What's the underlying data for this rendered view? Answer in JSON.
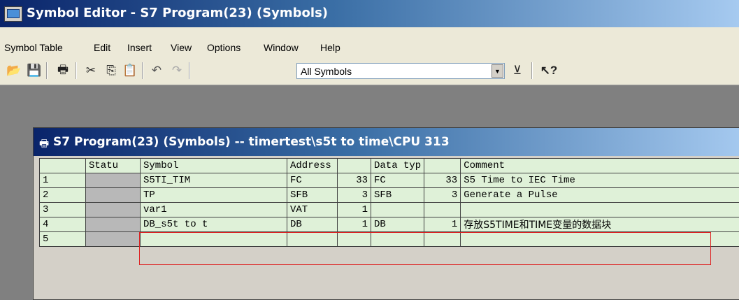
{
  "window": {
    "title": "Symbol Editor - S7 Program(23) (Symbols)"
  },
  "menu": [
    "Symbol Table",
    "Edit",
    "Insert",
    "View",
    "Options",
    "Window",
    "Help"
  ],
  "toolbar": {
    "icons": [
      "open-icon",
      "save-icon",
      "print-icon",
      "cut-icon",
      "copy-icon",
      "paste-icon",
      "undo-icon",
      "redo-icon",
      "filter-icon",
      "help-icon"
    ],
    "filter_value": "All Symbols"
  },
  "child": {
    "title": "S7 Program(23) (Symbols) -- timertest\\s5t to time\\CPU 313"
  },
  "table": {
    "headers": [
      "",
      "Statu",
      "Symbol",
      "Address",
      "",
      "Data typ",
      "",
      "Comment"
    ],
    "rows": [
      {
        "n": "1",
        "symbol": "S5TI_TIM",
        "addr": "FC",
        "addr_num": "33",
        "type": "FC",
        "type_num": "33",
        "comment": "S5 Time to IEC Time"
      },
      {
        "n": "2",
        "symbol": "TP",
        "addr": "SFB",
        "addr_num": "3",
        "type": "SFB",
        "type_num": "3",
        "comment": "Generate a Pulse"
      },
      {
        "n": "3",
        "symbol": "var1",
        "addr": "VAT",
        "addr_num": "1",
        "type": "",
        "type_num": "",
        "comment": ""
      },
      {
        "n": "4",
        "symbol": "DB_s5t to t",
        "addr": "DB",
        "addr_num": "1",
        "type": "DB",
        "type_num": "1",
        "comment": "存放S5TIME和TIME变量的数据块"
      },
      {
        "n": "5",
        "symbol": "",
        "addr": "",
        "addr_num": "",
        "type": "",
        "type_num": "",
        "comment": ""
      }
    ]
  },
  "colors": {
    "highlight": "#dd2222",
    "row_bg": "#dff1d8"
  }
}
